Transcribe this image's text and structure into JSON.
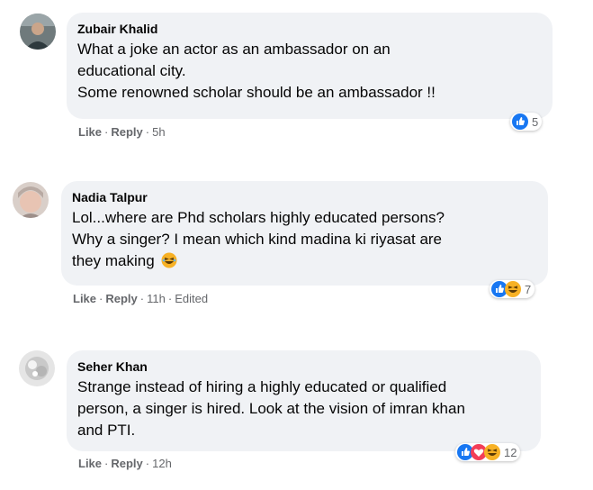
{
  "comments": [
    {
      "author": "Zubair Khalid",
      "lines": [
        "What a joke an actor as an ambassador on an",
        "educational city.",
        "Some renowned scholar should be an ambassador !!"
      ],
      "actions": {
        "like": "Like",
        "reply": "Reply",
        "time": "5h"
      },
      "reactions": {
        "icons": [
          "like-icon"
        ],
        "count": "5"
      }
    },
    {
      "author": "Nadia Talpur",
      "lines": [
        "Lol...where are Phd scholars highly educated persons?",
        "Why a singer? I mean which kind madina ki riyasat are",
        "they making"
      ],
      "actions": {
        "like": "Like",
        "reply": "Reply",
        "time": "11h",
        "edited": "Edited"
      },
      "reactions": {
        "icons": [
          "like-icon",
          "haha-icon"
        ],
        "count": "7"
      }
    },
    {
      "author": "Seher Khan",
      "lines": [
        "Strange instead of hiring a highly educated or qualified",
        "person, a singer is hired. Look at the vision of imran khan",
        "and PTI."
      ],
      "actions": {
        "like": "Like",
        "reply": "Reply",
        "time": "12h"
      },
      "reactions": {
        "icons": [
          "like-icon",
          "love-icon",
          "haha-icon"
        ],
        "count": "12"
      }
    }
  ],
  "colors": {
    "like": "#1877f2",
    "love": "#f33e58",
    "haha": "#f7b125",
    "bubble": "#f0f2f5",
    "meta": "#65676b"
  }
}
